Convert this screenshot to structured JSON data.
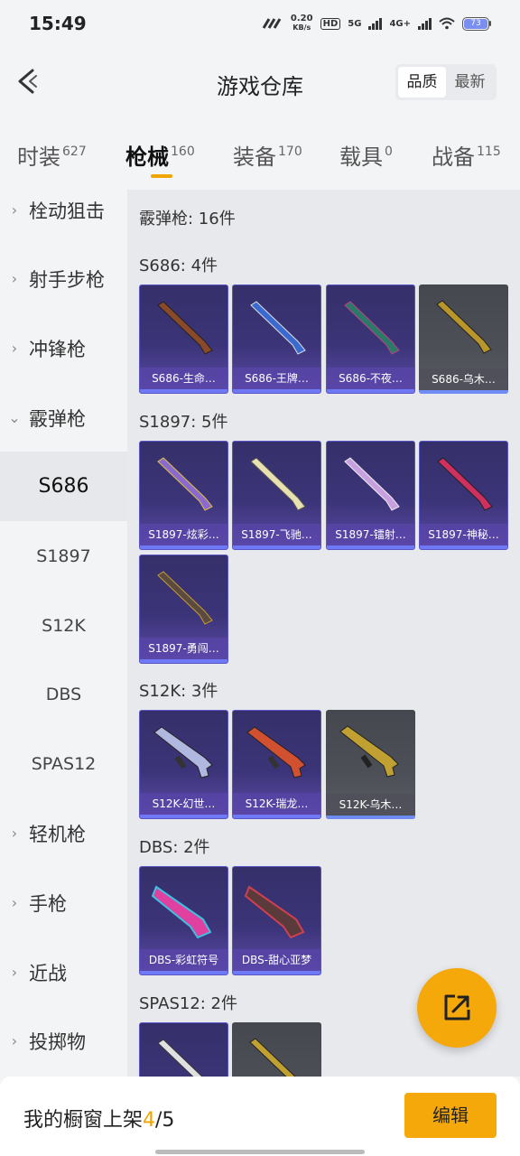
{
  "status_bar": {
    "time": "15:49",
    "speed_value": "0.20",
    "speed_unit": "KB/s",
    "hd_badge": "HD",
    "net1": "5G",
    "net2": "4G+",
    "battery": "73"
  },
  "header": {
    "title": "游戏仓库",
    "sort_quality": "品质",
    "sort_newest": "最新"
  },
  "tabs": [
    {
      "label": "时装",
      "count": "627"
    },
    {
      "label": "枪械",
      "count": "160"
    },
    {
      "label": "装备",
      "count": "170"
    },
    {
      "label": "载具",
      "count": "0"
    },
    {
      "label": "战备",
      "count": "115"
    }
  ],
  "sidebar": {
    "categories": [
      "栓动狙击",
      "射手步枪",
      "冲锋枪",
      "霰弹枪",
      "轻机枪",
      "手枪",
      "近战",
      "投掷物"
    ],
    "sub_items": [
      "S686",
      "S1897",
      "S12K",
      "DBS",
      "SPAS12"
    ]
  },
  "content": {
    "summary": "霰弹枪: 16件",
    "sections": [
      {
        "title": "S686: 4件",
        "items": [
          "S686-生命…",
          "S686-王牌…",
          "S686-不夜…",
          "S686-乌木…"
        ]
      },
      {
        "title": "S1897: 5件",
        "items": [
          "S1897-炫彩…",
          "S1897-飞驰…",
          "S1897-镭射…",
          "S1897-神秘…",
          "S1897-勇闯…"
        ]
      },
      {
        "title": "S12K: 3件",
        "items": [
          "S12K-幻世…",
          "S12K-瑞龙…",
          "S12K-乌木…"
        ]
      },
      {
        "title": "DBS: 2件",
        "items": [
          "DBS-彩虹符号",
          "DBS-甜心亚梦"
        ]
      },
      {
        "title": "SPAS12: 2件",
        "items": []
      }
    ]
  },
  "bottom": {
    "label": "我的橱窗上架",
    "current": "4",
    "total": "/5",
    "edit": "编辑"
  },
  "colors": {
    "accent": "#f5a80a",
    "card_purple": "#3b3478",
    "card_gray": "#4d5057"
  }
}
